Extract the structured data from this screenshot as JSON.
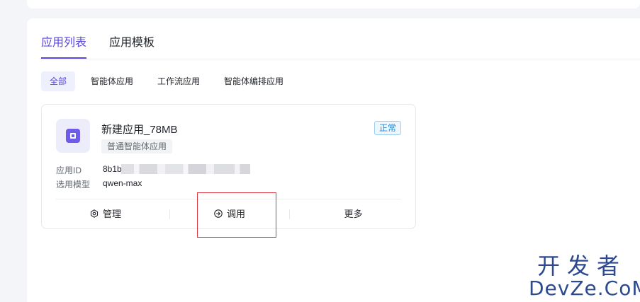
{
  "tabs": [
    {
      "label": "应用列表",
      "active": true
    },
    {
      "label": "应用模板",
      "active": false
    }
  ],
  "filters": [
    {
      "label": "全部",
      "active": true
    },
    {
      "label": "智能体应用",
      "active": false
    },
    {
      "label": "工作流应用",
      "active": false
    },
    {
      "label": "智能体编排应用",
      "active": false
    }
  ],
  "card": {
    "name": "新建应用_78MB",
    "type": "普通智能体应用",
    "status": "正常",
    "id_label": "应用ID",
    "id_value": "8b1b",
    "model_label": "选用模型",
    "model_value": "qwen-max",
    "icon": "app-square-icon",
    "actions": {
      "manage": "管理",
      "invoke": "调用",
      "more": "更多"
    }
  },
  "watermark": {
    "cn": "开发者",
    "en": "DevZe.CoM"
  },
  "colors": {
    "accent": "#5a47e0",
    "status": "#1f8ad8",
    "highlight_box": "#d9363e"
  }
}
